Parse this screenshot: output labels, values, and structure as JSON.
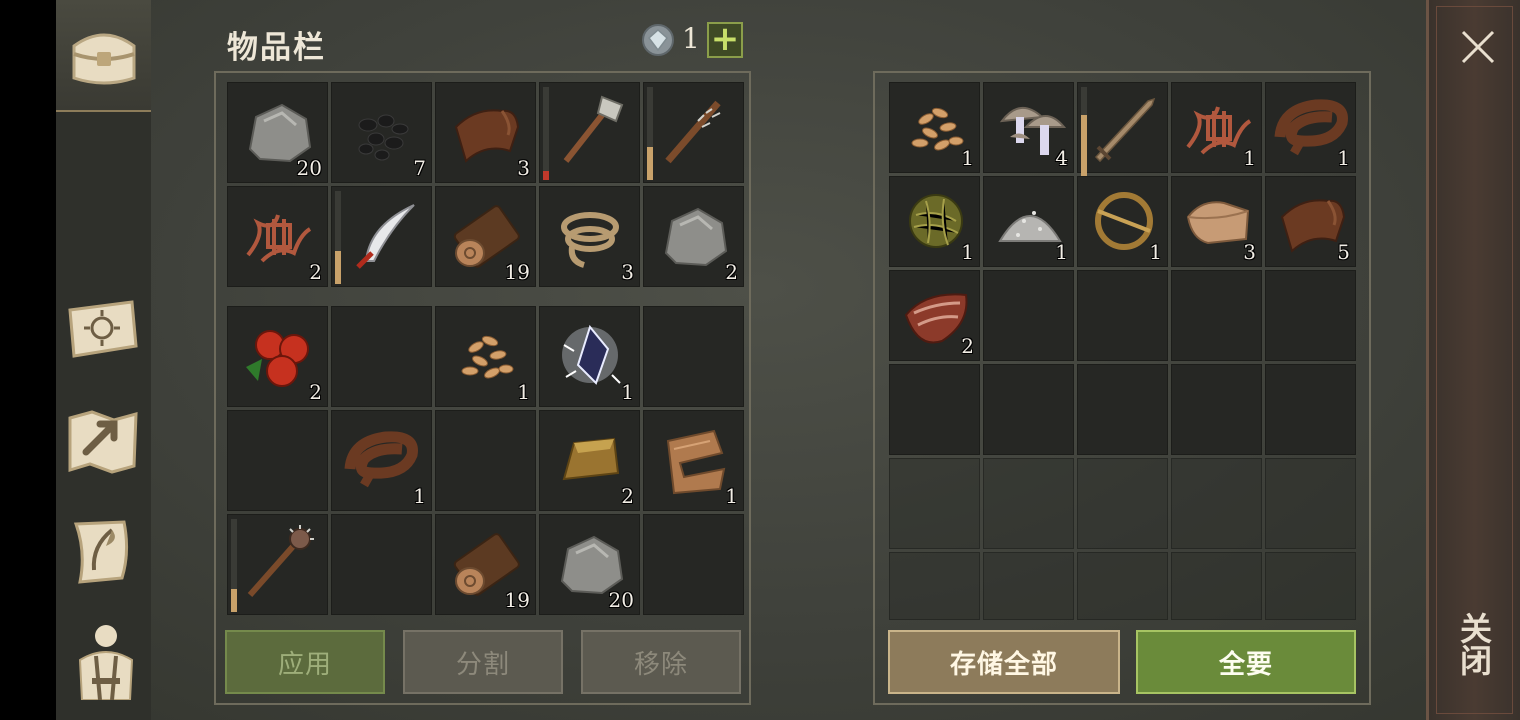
{
  "title": "物品栏",
  "currency": {
    "icon": "gem-icon",
    "count": "1",
    "add_label": "+"
  },
  "sidebar": {
    "tabs": [
      {
        "name": "chest-tab-icon"
      },
      {
        "name": "crafting-book-icon"
      },
      {
        "name": "map-icon"
      },
      {
        "name": "quest-scroll-icon"
      },
      {
        "name": "character-equipment-icon"
      }
    ]
  },
  "inventory": {
    "equipped_rows": [
      [
        {
          "icon": "stone",
          "count": "20"
        },
        {
          "icon": "coal",
          "count": "7"
        },
        {
          "icon": "leather",
          "count": "3"
        },
        {
          "icon": "stone-hatchet",
          "count": "",
          "durability": 0.1,
          "dur_color": "#c0392b"
        },
        {
          "icon": "spiked-club",
          "count": "",
          "durability": 0.35,
          "dur_color": "#c9a26a"
        }
      ],
      [
        {
          "icon": "sinew",
          "count": "2"
        },
        {
          "icon": "scimitar",
          "count": "",
          "durability": 0.35,
          "dur_color": "#c9a26a"
        },
        {
          "icon": "log",
          "count": "19"
        },
        {
          "icon": "rope",
          "count": "3"
        },
        {
          "icon": "stone",
          "count": "2"
        }
      ]
    ],
    "backpack_rows": [
      [
        {
          "icon": "berries",
          "count": "2"
        },
        {
          "icon": "",
          "count": ""
        },
        {
          "icon": "seeds",
          "count": "1"
        },
        {
          "icon": "crystal",
          "count": "1"
        },
        {
          "icon": "",
          "count": ""
        }
      ],
      [
        {
          "icon": "",
          "count": ""
        },
        {
          "icon": "leather-strip",
          "count": "1"
        },
        {
          "icon": "",
          "count": ""
        },
        {
          "icon": "gold-ingot",
          "count": "2"
        },
        {
          "icon": "cloth",
          "count": "1"
        }
      ],
      [
        {
          "icon": "mace",
          "count": "",
          "durability": 0.25,
          "dur_color": "#c9a26a"
        },
        {
          "icon": "",
          "count": ""
        },
        {
          "icon": "log",
          "count": "19"
        },
        {
          "icon": "stone",
          "count": "20"
        },
        {
          "icon": "",
          "count": ""
        }
      ]
    ],
    "buttons": {
      "apply": "应用",
      "split": "分割",
      "remove": "移除"
    }
  },
  "storage": {
    "rows": [
      [
        {
          "icon": "seeds",
          "count": "1"
        },
        {
          "icon": "mushrooms",
          "count": "4"
        },
        {
          "icon": "sword",
          "count": "",
          "durability": 0.7,
          "dur_color": "#c9a26a"
        },
        {
          "icon": "sinew",
          "count": "1"
        },
        {
          "icon": "leather-strip",
          "count": "1"
        }
      ],
      [
        {
          "icon": "plant-fiber-ball",
          "count": "1"
        },
        {
          "icon": "salt-pile",
          "count": "1"
        },
        {
          "icon": "brooch",
          "count": "1"
        },
        {
          "icon": "fabric",
          "count": "3"
        },
        {
          "icon": "leather",
          "count": "5"
        }
      ],
      [
        {
          "icon": "raw-meat",
          "count": "2"
        },
        {
          "icon": "",
          "count": ""
        },
        {
          "icon": "",
          "count": ""
        },
        {
          "icon": "",
          "count": ""
        },
        {
          "icon": "",
          "count": ""
        }
      ],
      [
        {
          "icon": "",
          "count": ""
        },
        {
          "icon": "",
          "count": ""
        },
        {
          "icon": "",
          "count": ""
        },
        {
          "icon": "",
          "count": ""
        },
        {
          "icon": "",
          "count": ""
        }
      ]
    ],
    "faded_rows": 2,
    "buttons": {
      "store_all": "存储全部",
      "take_all": "全要"
    }
  },
  "close": {
    "label": "关闭"
  },
  "colors": {
    "accent_green": "#6a8b3a",
    "accent_tan": "#8d7b5b",
    "slot_bg": "#262724"
  }
}
